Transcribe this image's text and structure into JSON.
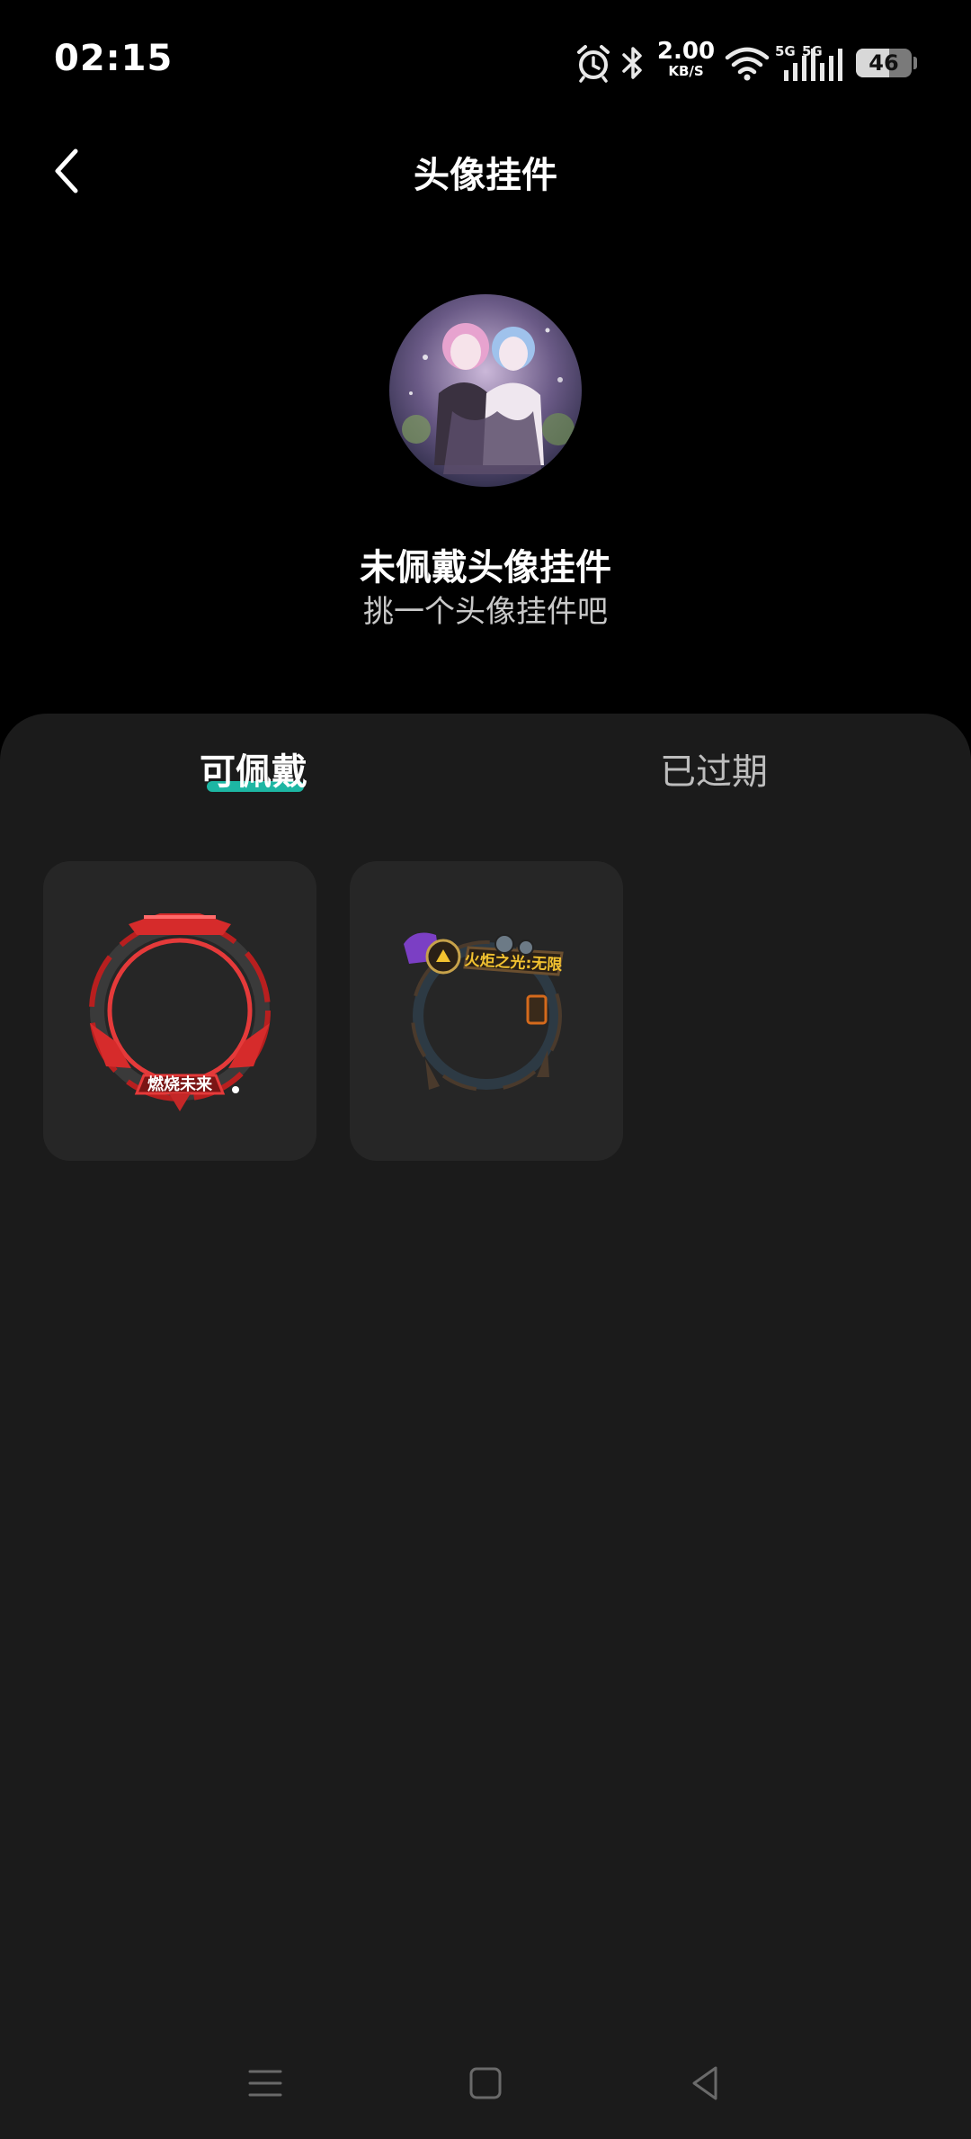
{
  "status_bar": {
    "time": "02:15",
    "net_speed_value": "2.00",
    "net_speed_unit": "KB/S",
    "signal1_label": "5G",
    "signal2_label": "5G",
    "battery": "46"
  },
  "header": {
    "title": "头像挂件"
  },
  "current": {
    "title": "未佩戴头像挂件",
    "subtitle": "挑一个头像挂件吧"
  },
  "tabs": [
    {
      "label": "可佩戴",
      "active": true
    },
    {
      "label": "已过期",
      "active": false
    }
  ],
  "pendants": [
    {
      "label": "燃烧未来",
      "accent": "#e53a3a"
    },
    {
      "label": "火炬之光:无限",
      "accent": "#f2c230"
    }
  ],
  "colors": {
    "background": "#000000",
    "sheet": "#1b1b1b",
    "card": "#262626",
    "tab_indicator": "#1db6a3"
  }
}
